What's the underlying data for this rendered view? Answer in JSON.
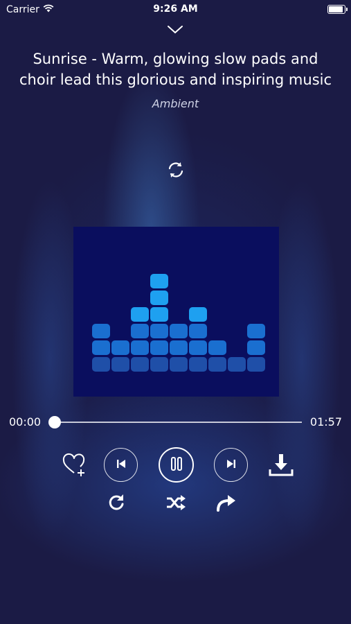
{
  "status_bar": {
    "carrier": "Carrier",
    "time": "9:26 AM"
  },
  "track": {
    "title": "Sunrise - Warm, glowing slow pads and choir lead this glorious and inspiring music",
    "genre": "Ambient"
  },
  "progress": {
    "elapsed": "00:00",
    "duration": "01:57",
    "fraction": 0
  },
  "icons": {
    "collapse": "chevron-down-icon",
    "repeat_mode": "refresh-icon",
    "favorite": "heart-plus-icon",
    "previous": "skip-previous-icon",
    "pause": "pause-icon",
    "next": "skip-next-icon",
    "download": "download-icon",
    "replay": "replay-icon",
    "shuffle": "shuffle-icon",
    "share": "share-arrow-icon"
  },
  "colors": {
    "background": "#1b1b45",
    "art_background": "#0a0e5e",
    "bar_light": "#1ea0f0",
    "bar_dark": "#1f4fa8"
  },
  "equalizer_levels": [
    3,
    2,
    4,
    6,
    3,
    4,
    2,
    1,
    3
  ]
}
